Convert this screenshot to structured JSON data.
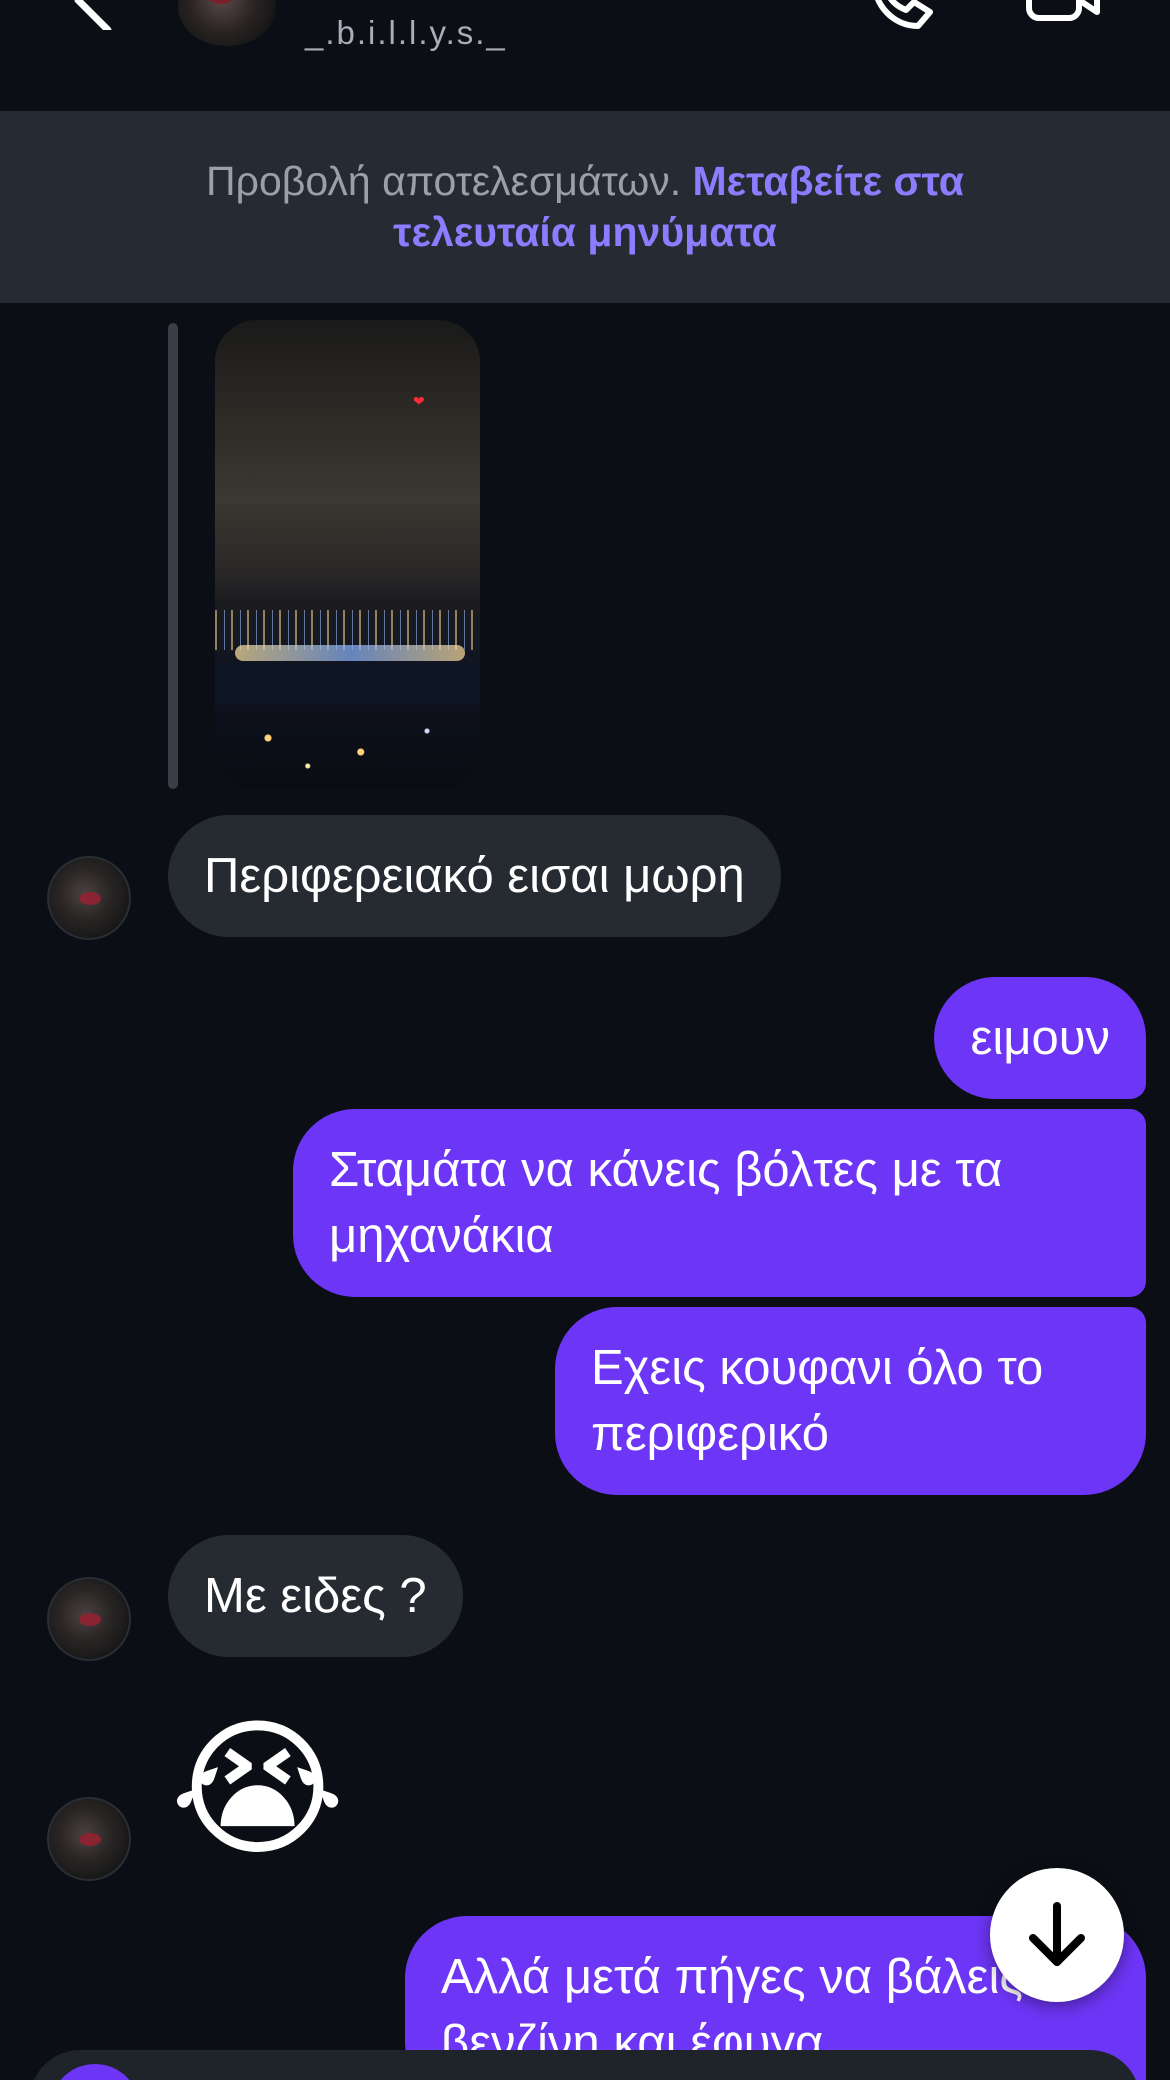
{
  "header": {
    "username": "_.b.i.l.l.y.s._"
  },
  "banner": {
    "text": "Προβολή αποτελεσμάτων.",
    "link": "Μεταβείτε στα τελευταία μηνύματα"
  },
  "messages": [
    {
      "side": "in",
      "text": "Περιφερειακό εισαι μωρη"
    },
    {
      "side": "out",
      "text": "ειμουν"
    },
    {
      "side": "out",
      "text": "Σταμάτα να κάνεις βόλτες με τα μηχανάκια"
    },
    {
      "side": "out",
      "text": "Εχεις κουφανι όλο το περιφερικό"
    },
    {
      "side": "in",
      "text": "Με ειδες ?"
    },
    {
      "side": "in",
      "text": "😭"
    },
    {
      "side": "out",
      "text": "Αλλά μετά πήγες να βάλεις βενζίνη και έφυγα"
    }
  ],
  "colors": {
    "accent": "#6d35f5",
    "link": "#8a7dff",
    "incoming_bubble": "#262a31",
    "background": "#0b0f15"
  },
  "icons": {
    "back": "chevron-left-icon",
    "call": "phone-icon",
    "video": "video-camera-icon",
    "scroll": "arrow-down-icon",
    "story_sticker": "heart-icon"
  }
}
